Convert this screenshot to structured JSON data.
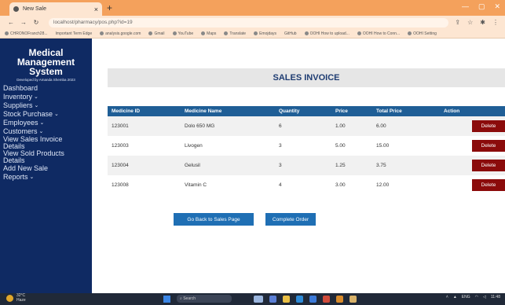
{
  "browser": {
    "tab_title": "New Sale",
    "url": "localhost/pharmacy/pos.php?id=19",
    "bookmarks": [
      "CHRONOFranch28...",
      "Important Term Edge",
      "analysis.google.com",
      "Gmail",
      "YouTube",
      "Maps",
      "Translate",
      "Emojdays",
      "GitHub",
      "OOHI How to upload...",
      "OOHI How to Conn...",
      "OOHI Setting"
    ]
  },
  "sidebar": {
    "brand_line1": "Medical",
    "brand_line2": "Management",
    "brand_line3": "System",
    "credit": "Developed by Amanda Shemba 2023",
    "items": [
      {
        "label": "Dashboard",
        "caret": ""
      },
      {
        "label": "Inventory",
        "caret": "⌄"
      },
      {
        "label": "Suppliers",
        "caret": "⌄"
      },
      {
        "label": "Stock Purchase",
        "caret": "⌄"
      },
      {
        "label": "Employees",
        "caret": "⌄"
      },
      {
        "label": "Customers",
        "caret": "⌄"
      },
      {
        "label": "View Sales Invoice",
        "label2": "Details"
      },
      {
        "label": "View Sold Products",
        "label2": "Details"
      },
      {
        "label": "Add New Sale",
        "caret": ""
      },
      {
        "label": "Reports",
        "caret": "⌄"
      }
    ]
  },
  "main": {
    "title": "SALES INVOICE",
    "columns": [
      "Medicine ID",
      "Medicine Name",
      "Quantity",
      "Price",
      "Total Price",
      "Action"
    ],
    "rows": [
      {
        "id": "123001",
        "name": "Dolo 650 MG",
        "qty": "6",
        "price": "1.00",
        "total": "6.00",
        "action": "Delete"
      },
      {
        "id": "123003",
        "name": "Livogen",
        "qty": "3",
        "price": "5.00",
        "total": "15.00",
        "action": "Delete"
      },
      {
        "id": "123004",
        "name": "Gelusil",
        "qty": "3",
        "price": "1.25",
        "total": "3.75",
        "action": "Delete"
      },
      {
        "id": "123008",
        "name": "Vitamin C",
        "qty": "4",
        "price": "3.00",
        "total": "12.00",
        "action": "Delete"
      }
    ],
    "back_button": "Go Back to Sales Page",
    "complete_button": "Complete Order"
  },
  "taskbar": {
    "weather": "32°C",
    "weather_sub": "Haze",
    "search_placeholder": "Search",
    "tray_lang": "ENG",
    "tray_time": "11:48"
  },
  "colors": {
    "sidebar_bg": "#0f2a63",
    "table_header": "#1f5e96",
    "delete_btn": "#8b0b0b",
    "primary_btn": "#1f6fb4"
  }
}
